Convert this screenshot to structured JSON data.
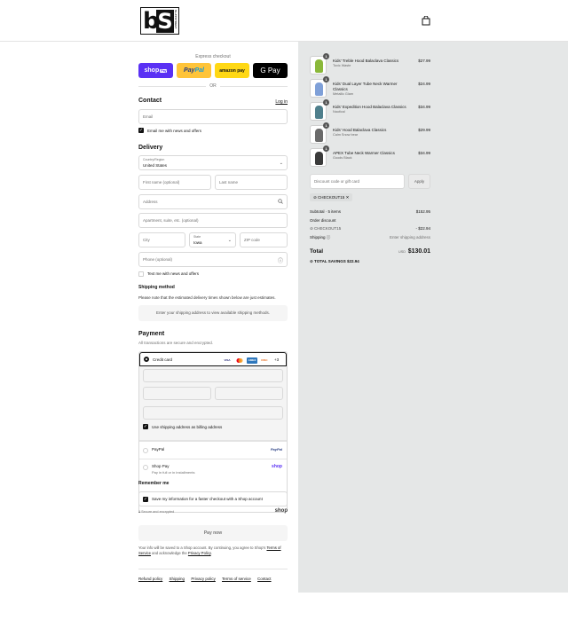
{
  "header": {
    "logo_letter_b": "b",
    "logo_letter_s": "S",
    "logo_side_text": "SLAYSTREET",
    "cart_icon": "shopping-bag-icon"
  },
  "express": {
    "label": "Express checkout",
    "shop_pay": "shop",
    "shop_pay_tag": "Pay",
    "paypal_a": "Pay",
    "paypal_b": "Pal",
    "amazon_pay": "amazon pay",
    "google_pay": "G Pay",
    "or": "OR"
  },
  "contact": {
    "title": "Contact",
    "login": "Log in",
    "email_placeholder": "Email",
    "news_label": "Email me with news and offers"
  },
  "delivery": {
    "title": "Delivery",
    "country_label": "Country/Region",
    "country_value": "United States",
    "first_name_ph": "First name (optional)",
    "last_name_ph": "Last name",
    "address_ph": "Address",
    "apartment_ph": "Apartment, suite, etc. (optional)",
    "city_ph": "City",
    "state_label": "State",
    "state_value": "Iowa",
    "zip_ph": "ZIP code",
    "phone_ph": "Phone (optional)",
    "text_label": "Text me with news and offers"
  },
  "shipping": {
    "title": "Shipping method",
    "note": "Please note that the estimated delivery times shown below are just estimates.",
    "placeholder": "Enter your shipping address to view available shipping methods."
  },
  "payment": {
    "title": "Payment",
    "subtitle": "All transactions are secure and encrypted.",
    "credit_card": "Credit card",
    "cards": [
      "VISA",
      "MC",
      "AMEX",
      "DISC"
    ],
    "more_cards": "+3",
    "billing_label": "Use shipping address as billing address",
    "paypal": "PayPal",
    "paypal_logo": "PayPal",
    "shop_pay": "Shop Pay",
    "shop_pay_sub": "Pay in full or in installments",
    "shop_logo": "shop"
  },
  "remember": {
    "title": "Remember me",
    "save_label": "Save my information for a faster checkout with a Shop account",
    "secure": "Secure and encrypted",
    "shop_logo": "shop"
  },
  "pay_now": "Pay now",
  "legal": {
    "text1": "Your info will be saved to a Shop account. By continuing, you agree to Shop's",
    "terms": "Terms of Service",
    "text2": "and acknowledge the",
    "privacy": "Privacy Policy",
    "text3": "."
  },
  "footer": [
    "Refund policy",
    "Shipping",
    "Privacy policy",
    "Terms of service",
    "Contact"
  ],
  "summary": {
    "items": [
      {
        "qty": "1",
        "name": "Kids' Treble Hood Balaclava Classics",
        "variant": "Toxic Waste",
        "price": "$27.99",
        "color": "#8ab83a"
      },
      {
        "qty": "1",
        "name": "Kids' Dual Layer Tube Neck Warmer Classics",
        "variant": "Metallic Glam",
        "price": "$24.99",
        "color": "#7fa0d8"
      },
      {
        "qty": "1",
        "name": "Kids' Expedition Hood Balaclava Classics",
        "variant": "Nautical",
        "price": "$34.99",
        "color": "#4f7f8c"
      },
      {
        "qty": "1",
        "name": "Kids' Hood Balaclava Classics",
        "variant": "Calm Snow bear",
        "price": "$29.99",
        "color": "#6a6a6a"
      },
      {
        "qty": "1",
        "name": "APEX Tube Neck Warmer Classics",
        "variant": "Goods Black",
        "price": "$34.99",
        "color": "#3a3a3a"
      }
    ],
    "discount_ph": "Discount code or gift card",
    "apply": "Apply",
    "code_chip": "CHECKOUT15",
    "subtotal_label": "Subtotal · 5 items",
    "subtotal": "$152.95",
    "order_discount": "Order discount",
    "discount_code": "CHECKOUT15",
    "discount_amount": "- $22.94",
    "shipping_label": "Shipping",
    "shipping_value": "Enter shipping address",
    "total_label": "Total",
    "currency": "USD",
    "total": "$130.01",
    "savings_label": "TOTAL SAVINGS",
    "savings": "$22.94"
  }
}
